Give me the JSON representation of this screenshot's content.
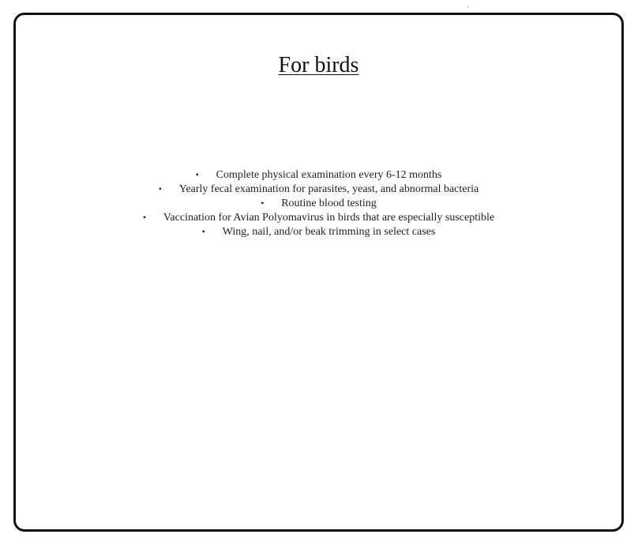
{
  "document": {
    "title": "For birds",
    "items": [
      "Complete physical examination every 6-12 months",
      "Yearly fecal examination for parasites, yeast, and abnormal bacteria",
      "Routine blood testing",
      "Vaccination for Avian Polyomavirus in birds that are especially susceptible",
      "Wing, nail, and/or beak trimming in select cases"
    ],
    "bullet": "•"
  },
  "colors": {
    "border": "#111111",
    "text": "#222222",
    "background": "#ffffff"
  }
}
